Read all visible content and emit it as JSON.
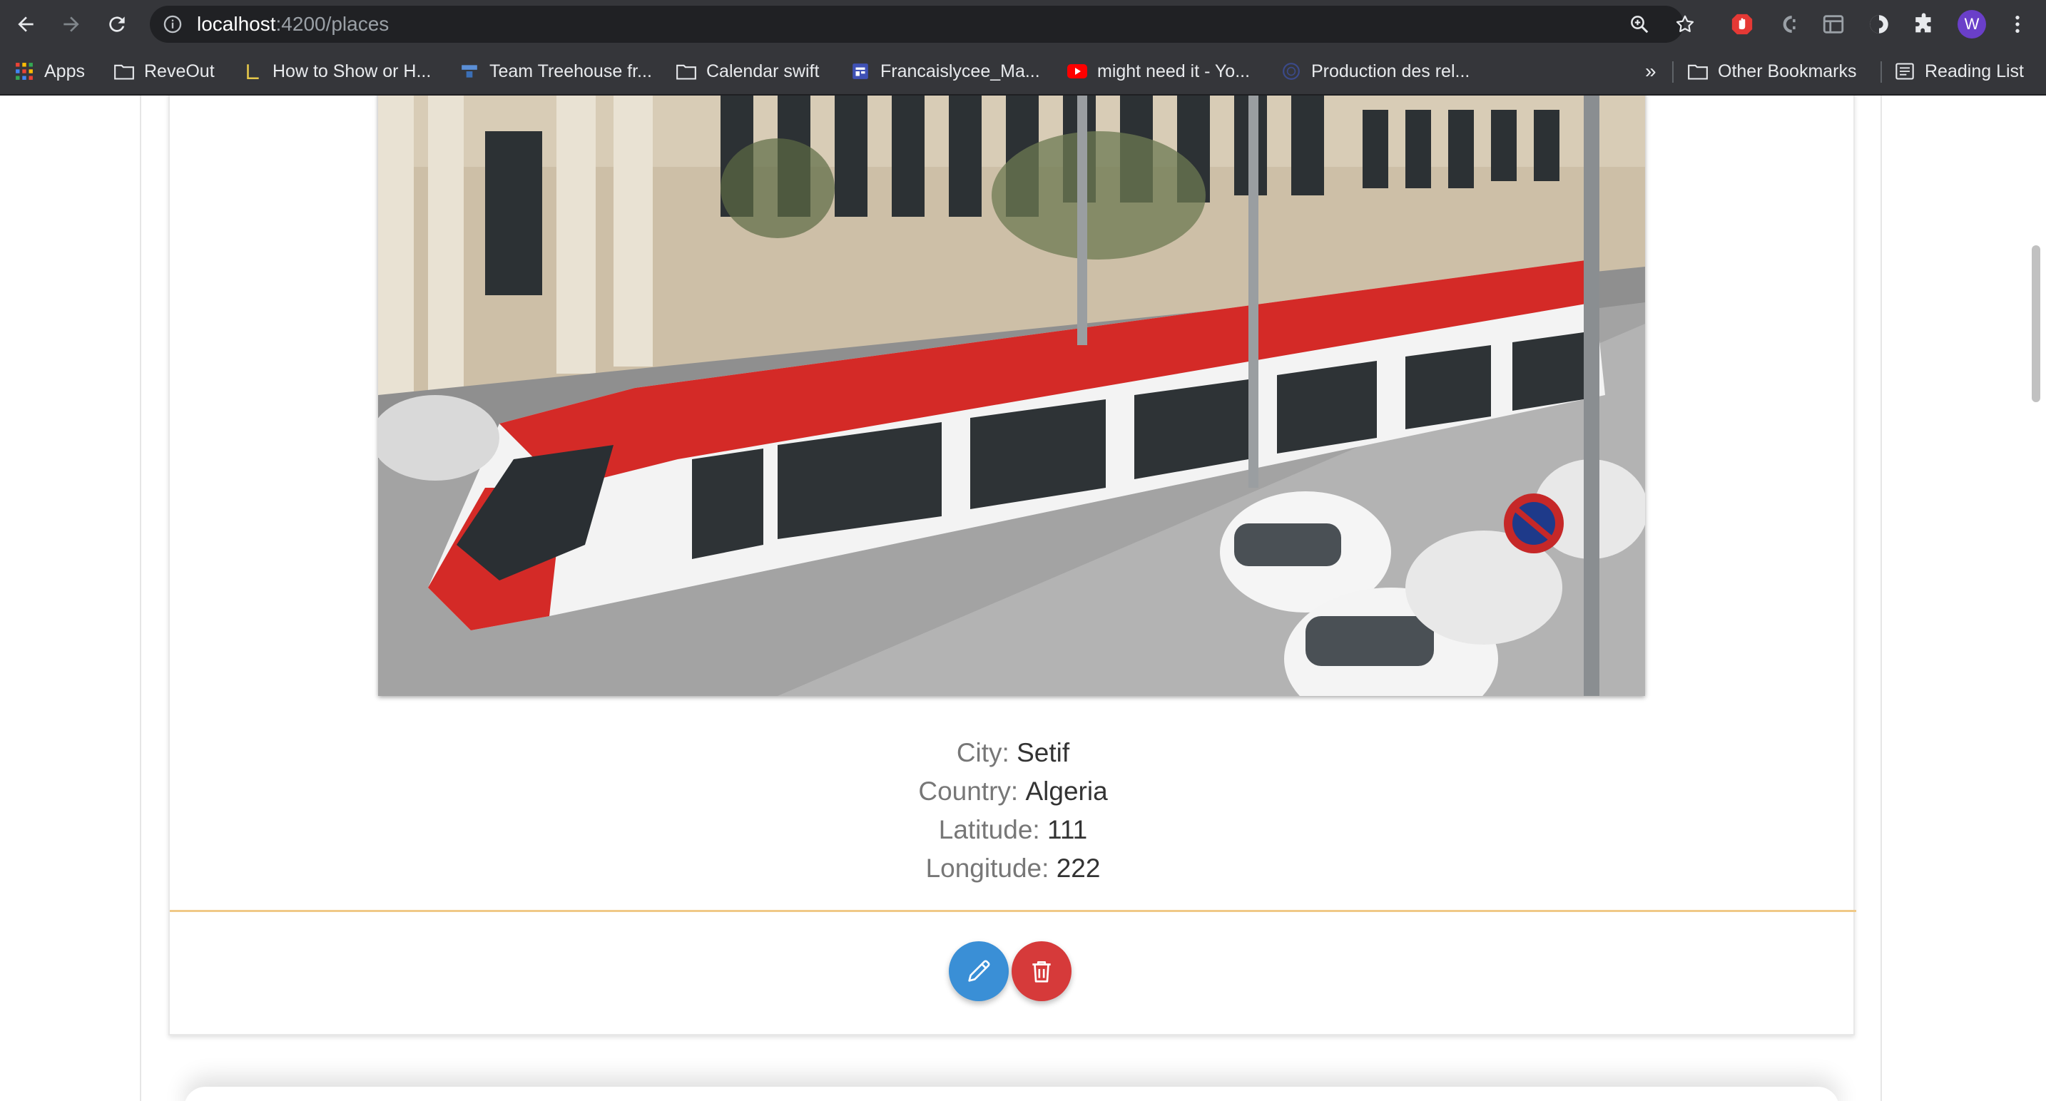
{
  "browser": {
    "url_host": "localhost",
    "url_path": ":4200/places",
    "profile_initial": "W"
  },
  "bookmarks": {
    "apps": "Apps",
    "items": [
      "ReveOut",
      "How to Show or H...",
      "Team Treehouse fr...",
      "Calendar swift",
      "Francaislycee_Ma...",
      "might need it - Yo...",
      "Production des rel..."
    ],
    "overflow": "»",
    "other": "Other Bookmarks",
    "reading_list": "Reading List"
  },
  "place": {
    "city_label": "City:",
    "city": "Setif",
    "country_label": "Country:",
    "country": "Algeria",
    "latitude_label": "Latitude:",
    "latitude": "111",
    "longitude_label": "Longitude:",
    "longitude": "222"
  },
  "colors": {
    "edit_button": "#3a8fd6",
    "delete_button": "#d63a3a",
    "divider": "#f0c987",
    "tram_red": "#d42a27"
  }
}
